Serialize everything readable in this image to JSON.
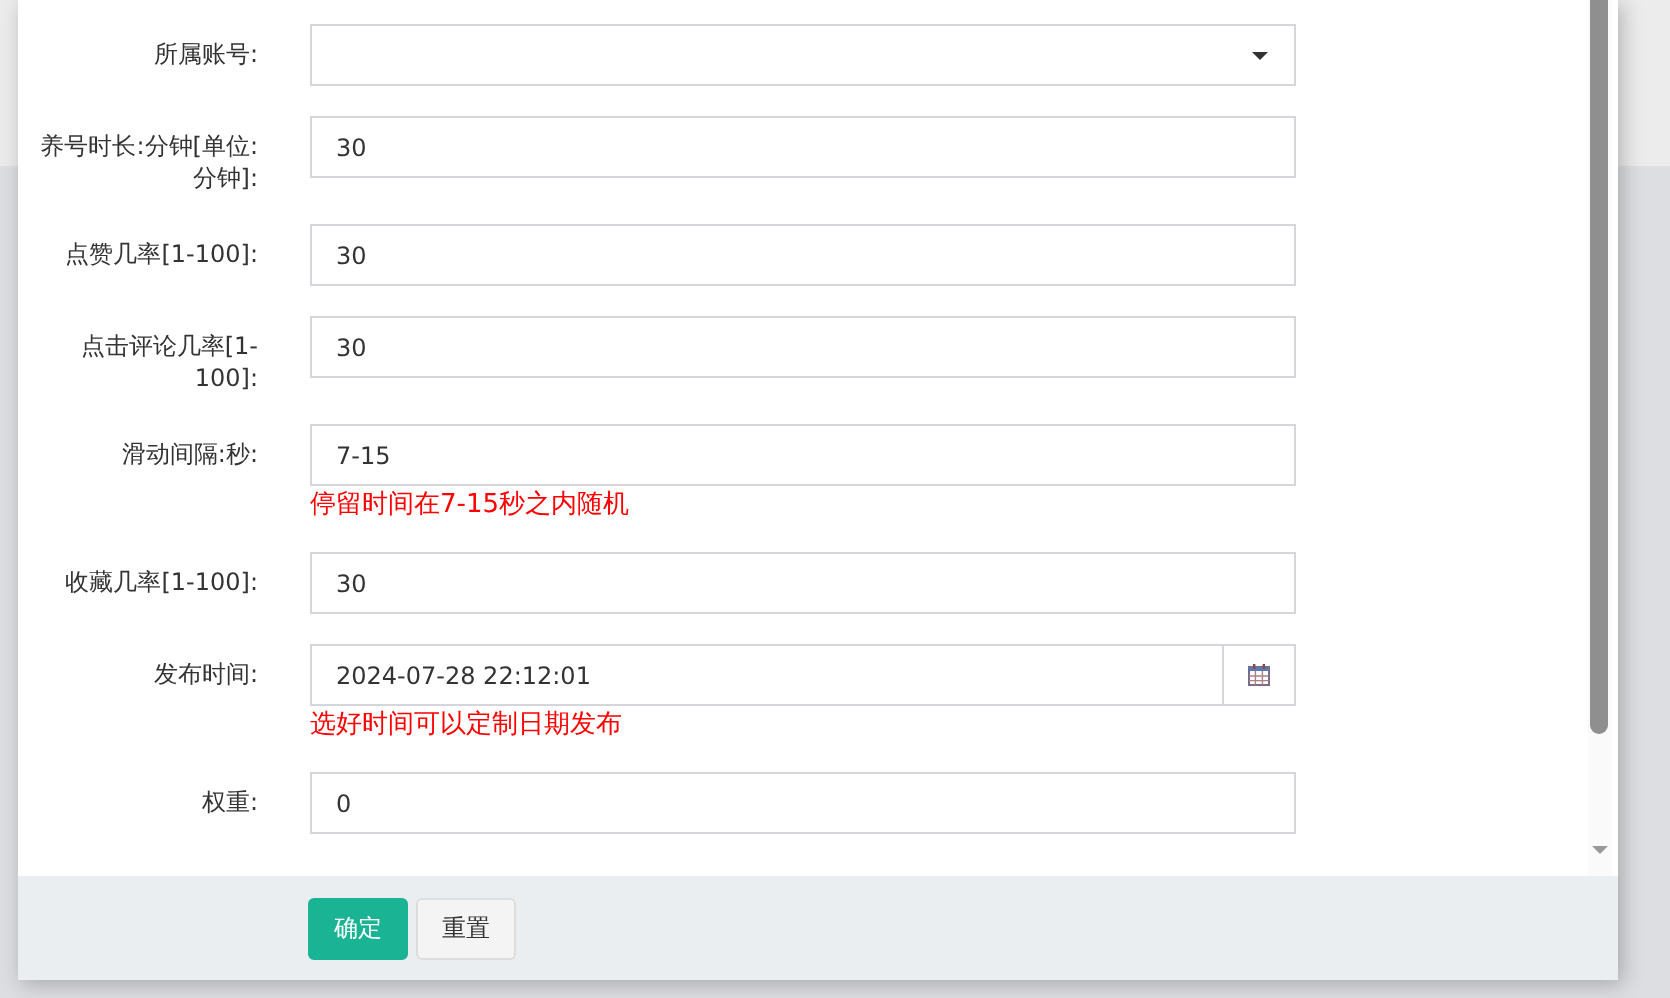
{
  "form": {
    "fields": [
      {
        "kind": "select",
        "label": "所属账号:"
      },
      {
        "kind": "text",
        "label": "养号时长:分钟[单位:分钟]:",
        "value": "30"
      },
      {
        "kind": "text",
        "label": "点赞几率[1-100]:",
        "value": "30"
      },
      {
        "kind": "text",
        "label": "点击评论几率[1-100]:",
        "value": "30"
      },
      {
        "kind": "text",
        "label": "滑动间隔:秒:",
        "value": "7-15",
        "hint": "停留时间在7-15秒之内随机"
      },
      {
        "kind": "text",
        "label": "收藏几率[1-100]:",
        "value": "30"
      },
      {
        "kind": "date",
        "label": "发布时间:",
        "value": "2024-07-28 22:12:01",
        "hint": "选好时间可以定制日期发布"
      },
      {
        "kind": "text",
        "label": "权重:",
        "value": "0"
      }
    ]
  },
  "buttons": [
    {
      "kind": "primary",
      "label": "确定"
    },
    {
      "kind": "default",
      "label": "重置"
    }
  ]
}
